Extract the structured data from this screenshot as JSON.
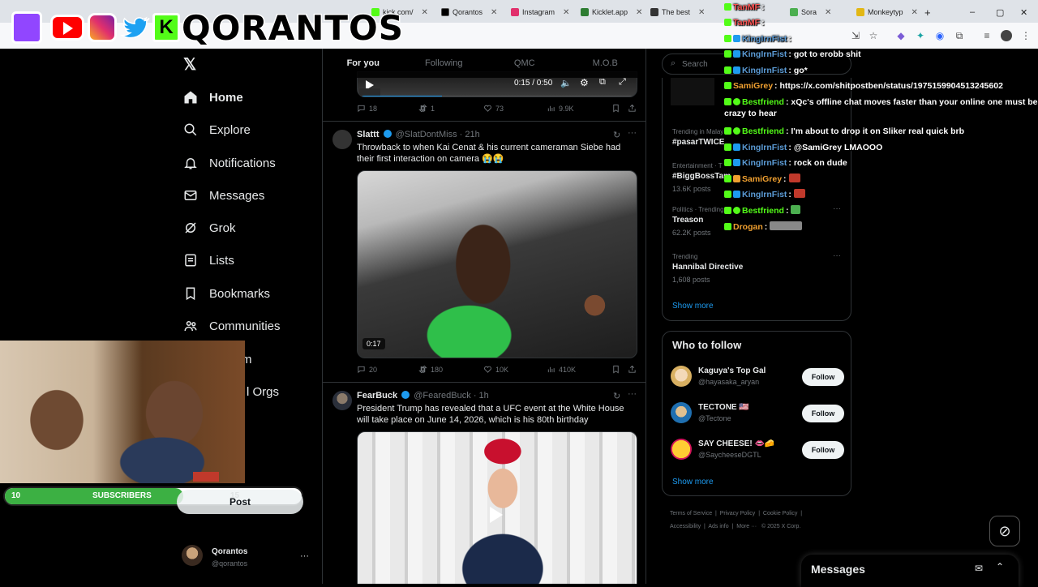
{
  "browser": {
    "tabs": [
      {
        "label": "kick.com/",
        "color": "#53fc18"
      },
      {
        "label": "Qorantos",
        "color": "#000000"
      },
      {
        "label": "Instagram",
        "color": "#e1306c"
      },
      {
        "label": "Kicklet.app",
        "color": "#53fc18"
      },
      {
        "label": "The best",
        "color": "#333333"
      },
      {
        "label": "Sora",
        "color": "#4caf50"
      },
      {
        "label": "Monkeytyp",
        "color": "#e2b714"
      }
    ],
    "new_tab": "+",
    "window_controls": [
      "–",
      "▢",
      "✕"
    ]
  },
  "overlay_banner": {
    "name": "QORANTOS",
    "social_icons": [
      "twitch-icon",
      "youtube-icon",
      "instagram-icon",
      "twitter-icon",
      "kick-icon"
    ]
  },
  "nav": {
    "items": [
      {
        "label": "Home",
        "icon": "home-icon"
      },
      {
        "label": "Explore",
        "icon": "search-icon"
      },
      {
        "label": "Notifications",
        "icon": "bell-icon"
      },
      {
        "label": "Messages",
        "icon": "mail-icon"
      },
      {
        "label": "Grok",
        "icon": "grok-icon"
      },
      {
        "label": "Lists",
        "icon": "list-icon"
      },
      {
        "label": "Bookmarks",
        "icon": "bookmark-icon"
      },
      {
        "label": "Communities",
        "icon": "communities-icon"
      },
      {
        "label": "m",
        "icon": ""
      },
      {
        "label": "l Orgs",
        "icon": ""
      }
    ],
    "post_button": "Post",
    "account": {
      "name": "Qorantos",
      "handle": "@qorantos",
      "more": "···"
    }
  },
  "sub_goal": {
    "current": "10",
    "label": "SUBSCRIBERS",
    "goal": "15",
    "progress_fraction": 0.67
  },
  "feed": {
    "tabs": [
      "For you",
      "Following",
      "QMC",
      "M.O.B"
    ],
    "video_player": {
      "time": "0:15 / 0:50"
    },
    "post0_stats": {
      "replies": "18",
      "reposts": "1",
      "likes": "73",
      "views": "9.9K"
    },
    "post1": {
      "name": "Slattt",
      "handle": "@SlatDontMiss",
      "time": "· 21h",
      "text": "Throwback to when Kai Cenat & his current cameraman Siebe had their first interaction on camera 😭😭",
      "duration": "0:17",
      "stats": {
        "replies": "20",
        "reposts": "180",
        "likes": "10K",
        "views": "410K"
      }
    },
    "post2": {
      "name": "FearBuck",
      "handle": "@FearedBuck",
      "time": "· 1h",
      "text": "President Trump has revealed that a UFC event at the White House will take place on June 14, 2026, which is his 80th birthday"
    }
  },
  "right": {
    "search_placeholder": "Search",
    "trends": [
      {
        "meta": "Trending in Malay",
        "name": "#pasarTWICE",
        "count": ""
      },
      {
        "meta": "Entertainment · T",
        "name": "#BiggBossTam",
        "count": "13.6K posts"
      },
      {
        "meta": "Politics · Trending",
        "name": "Treason",
        "count": "62.2K posts"
      },
      {
        "meta": "Trending",
        "name": "Hannibal Directive",
        "count": "1,608 posts"
      }
    ],
    "show_more": "Show more",
    "who_to_follow": {
      "title": "Who to follow",
      "users": [
        {
          "name": "Kaguya's Top Gal",
          "handle": "@hayasaka_aryan"
        },
        {
          "name": "TECTONE 🇺🇸",
          "handle": "@Tectone"
        },
        {
          "name": "SAY CHEESE! 👄🧀",
          "handle": "@SaycheeseDGTL"
        }
      ],
      "follow_label": "Follow",
      "show_more": "Show more"
    },
    "footer": [
      "Terms of Service",
      "Privacy Policy",
      "Cookie Policy",
      "Accessibility",
      "Ads info",
      "More ···",
      "© 2025 X Corp."
    ],
    "messages_label": "Messages"
  },
  "chat": [
    {
      "user": "TanMF",
      "msg": ":",
      "color": "#ff5555"
    },
    {
      "user": "TanMF",
      "msg": ":",
      "color": "#ff5555"
    },
    {
      "user": "KingIrnFist",
      "msg": ":",
      "color": "#5b9bd5"
    },
    {
      "user": "KingIrnFist",
      "msg": ": got to erobb shit",
      "color": "#5b9bd5"
    },
    {
      "user": "KingIrnFist",
      "msg": ": go*",
      "color": "#5b9bd5"
    },
    {
      "user": "SamiGrey",
      "msg": ": https://x.com/shitpostben/status/1975159904513245602",
      "color": "#f0a030"
    },
    {
      "user": "Bestfriend",
      "msg": ": xQc's offline chat moves faster than your online one must be crazy to hear",
      "color": "#53fc18"
    },
    {
      "user": "Bestfriend",
      "msg": ": I'm about to drop it on Sliker real quick brb",
      "color": "#53fc18"
    },
    {
      "user": "KingIrnFist",
      "msg": ": @SamiGrey LMAOOO",
      "color": "#5b9bd5"
    },
    {
      "user": "KingIrnFist",
      "msg": ": rock on dude",
      "color": "#5b9bd5"
    },
    {
      "user": "SamiGrey",
      "msg": ":",
      "color": "#f0a030"
    },
    {
      "user": "KingIrnFist",
      "msg": ":",
      "color": "#5b9bd5"
    },
    {
      "user": "Bestfriend",
      "msg": ":",
      "color": "#53fc18"
    },
    {
      "user": "Drogan",
      "msg": ":",
      "color": "#f0a030"
    }
  ]
}
